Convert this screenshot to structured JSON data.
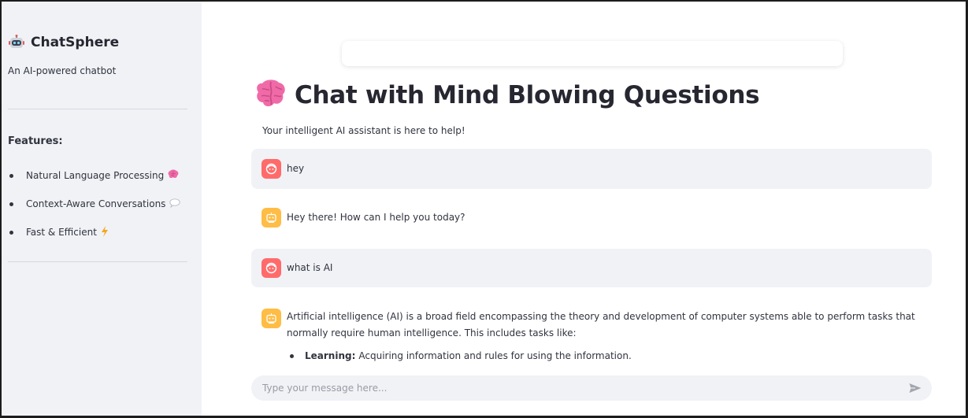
{
  "sidebar": {
    "brand": {
      "title": "ChatSphere",
      "icon": "robot-icon"
    },
    "tagline": "An AI-powered chatbot",
    "features_title": "Features:",
    "features": [
      {
        "label": "Natural Language Processing",
        "icon": "brain-icon"
      },
      {
        "label": "Context-Aware Conversations",
        "icon": "speech-bubble-icon"
      },
      {
        "label": "Fast & Efficient",
        "icon": "lightning-icon"
      }
    ]
  },
  "main": {
    "title": "Chat with Mind Blowing Questions",
    "title_icon": "brain-icon",
    "subtitle": "Your intelligent AI assistant is here to help!",
    "messages": [
      {
        "role": "user",
        "text": "hey"
      },
      {
        "role": "assistant",
        "text": "Hey there! How can I help you today?"
      },
      {
        "role": "user",
        "text": "what is AI"
      },
      {
        "role": "assistant",
        "text": "Artificial intelligence (AI) is a broad field encompassing the theory and development of computer systems able to perform tasks that normally require human intelligence. This includes tasks like:",
        "list": [
          {
            "term": "Learning:",
            "desc": "Acquiring information and rules for using the information."
          }
        ]
      }
    ],
    "input": {
      "placeholder": "Type your message here...",
      "value": ""
    }
  },
  "colors": {
    "sidebar_bg": "#f0f2f6",
    "user_avatar": "#ff6b6b",
    "bot_avatar": "#ffbd45",
    "user_bubble": "#f0f2f6",
    "brain": "#f06aa8"
  }
}
